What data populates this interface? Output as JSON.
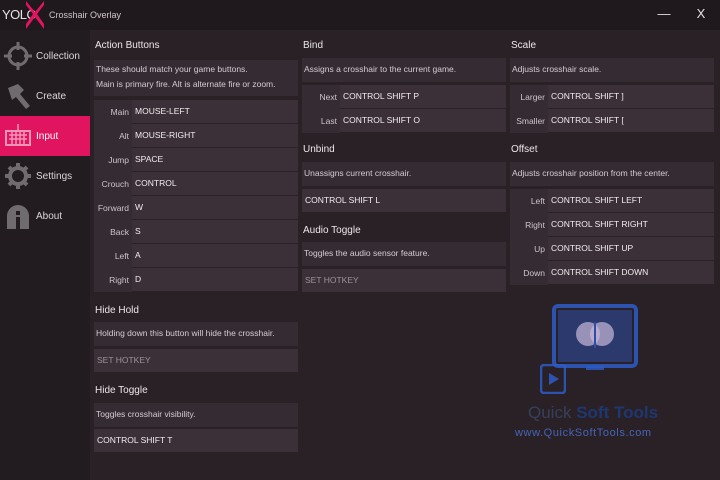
{
  "app": {
    "logo_text": "YOLO",
    "title": "Crosshair Overlay",
    "minimize_glyph": "—",
    "close_glyph": "X"
  },
  "colors": {
    "accent": "#e0145f",
    "background": "#2a2127",
    "sidebar": "#221b20"
  },
  "sidebar": {
    "items": [
      {
        "label": "Collection",
        "icon": "crosshair-icon",
        "active": false
      },
      {
        "label": "Create",
        "icon": "hammer-icon",
        "active": false
      },
      {
        "label": "Input",
        "icon": "keyboard-icon",
        "active": true
      },
      {
        "label": "Settings",
        "icon": "gear-icon",
        "active": false
      },
      {
        "label": "About",
        "icon": "info-icon",
        "active": false
      }
    ]
  },
  "action_buttons": {
    "title": "Action Buttons",
    "desc_line1": "These should match your game buttons.",
    "desc_line2": "Main is primary fire. Alt is alternate fire or zoom.",
    "rows": [
      {
        "label": "Main",
        "value": "MOUSE-LEFT"
      },
      {
        "label": "Alt",
        "value": "MOUSE-RIGHT"
      },
      {
        "label": "Jump",
        "value": "SPACE"
      },
      {
        "label": "Crouch",
        "value": "CONTROL"
      },
      {
        "label": "Forward",
        "value": "W"
      },
      {
        "label": "Back",
        "value": "S"
      },
      {
        "label": "Left",
        "value": "A"
      },
      {
        "label": "Right",
        "value": "D"
      }
    ]
  },
  "hide_hold": {
    "title": "Hide Hold",
    "desc": "Holding down this button will hide the crosshair.",
    "value": "SET HOTKEY"
  },
  "hide_toggle": {
    "title": "Hide Toggle",
    "desc": "Toggles crosshair visibility.",
    "value": "CONTROL SHIFT T"
  },
  "bind": {
    "title": "Bind",
    "desc": "Assigns a crosshair to the current game.",
    "rows": [
      {
        "label": "Next",
        "value": "CONTROL SHIFT P"
      },
      {
        "label": "Last",
        "value": "CONTROL SHIFT O"
      }
    ]
  },
  "unbind": {
    "title": "Unbind",
    "desc": "Unassigns current crosshair.",
    "value": "CONTROL SHIFT L"
  },
  "audio_toggle": {
    "title": "Audio Toggle",
    "desc": "Toggles the audio sensor feature.",
    "value": "SET HOTKEY"
  },
  "scale": {
    "title": "Scale",
    "desc": "Adjusts crosshair scale.",
    "rows": [
      {
        "label": "Larger",
        "value": "CONTROL SHIFT ]"
      },
      {
        "label": "Smaller",
        "value": "CONTROL SHIFT ["
      }
    ]
  },
  "offset": {
    "title": "Offset",
    "desc": "Adjusts crosshair position from the center.",
    "rows": [
      {
        "label": "Left",
        "value": "CONTROL SHIFT LEFT"
      },
      {
        "label": "Right",
        "value": "CONTROL SHIFT RIGHT"
      },
      {
        "label": "Up",
        "value": "CONTROL SHIFT UP"
      },
      {
        "label": "Down",
        "value": "CONTROL SHIFT DOWN"
      }
    ]
  },
  "watermark": {
    "brand_q": "Quick",
    "brand_rest": " Soft Tools",
    "url": "www.QuickSoftTools.com"
  }
}
